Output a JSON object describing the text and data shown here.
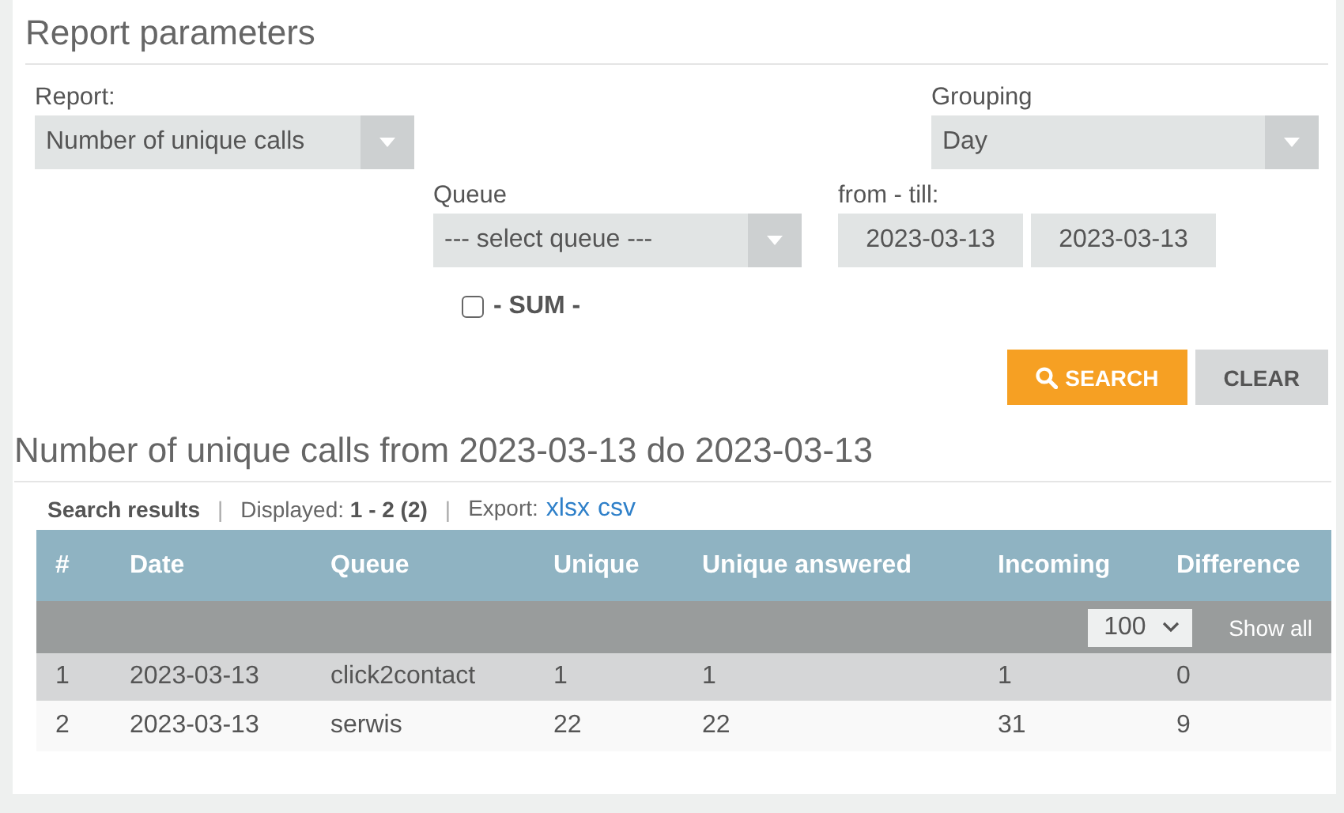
{
  "title": "Report parameters",
  "report": {
    "label": "Report:",
    "value": "Number of unique calls"
  },
  "grouping": {
    "label": "Grouping",
    "value": "Day"
  },
  "queue": {
    "label": "Queue",
    "value": "--- select queue ---"
  },
  "period": {
    "label": "from - till:",
    "from": "2023-03-13",
    "till": "2023-03-13"
  },
  "sum": {
    "label": "- SUM -",
    "checked": false
  },
  "buttons": [
    {
      "label": "SEARCH",
      "kind": "primary"
    },
    {
      "label": "CLEAR",
      "kind": "secondary"
    }
  ],
  "results": {
    "title": "Number of unique calls from 2023-03-13 do 2023-03-13",
    "summary": {
      "label": "Search results",
      "separators": [
        "|",
        "|"
      ],
      "displayed_label": "Displayed:",
      "displayed": "1 - 2 (2)",
      "export_label": "Export:",
      "export_links": [
        "xlsx",
        "csv"
      ]
    },
    "columns": [
      "#",
      "Date",
      "Queue",
      "Unique",
      "Unique answered",
      "Incoming",
      "Difference"
    ],
    "page_size": "100",
    "show_all": "Show all",
    "rows": [
      [
        "1",
        "2023-03-13",
        "click2contact",
        "1",
        "1",
        "1",
        "0"
      ],
      [
        "2",
        "2023-03-13",
        "serwis",
        "22",
        "22",
        "31",
        "9"
      ]
    ]
  }
}
